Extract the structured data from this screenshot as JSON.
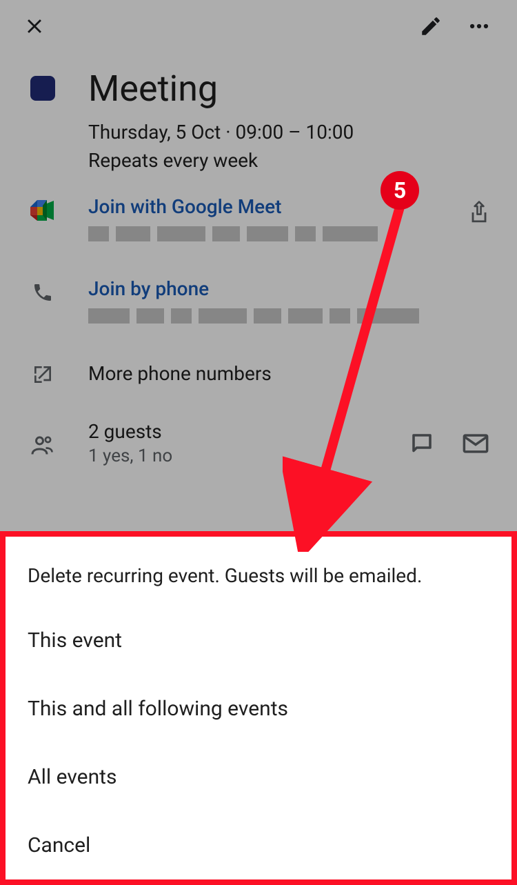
{
  "header": {
    "close_label": "Close",
    "edit_label": "Edit",
    "more_label": "More options"
  },
  "event": {
    "color": "#212c76",
    "title": "Meeting",
    "date_line": "Thursday, 5 Oct · 09:00 – 10:00",
    "repeat_line": "Repeats every week"
  },
  "meet": {
    "join_label": "Join with Google Meet",
    "share_label": "Share"
  },
  "phone": {
    "join_label": "Join by phone"
  },
  "more_numbers": {
    "label": "More phone numbers"
  },
  "guests": {
    "title": "2 guests",
    "summary": "1 yes, 1 no",
    "chat_label": "Chat",
    "email_label": "Email"
  },
  "sheet": {
    "title": "Delete recurring event. Guests will be emailed.",
    "options": [
      "This event",
      "This and all following events",
      "All events",
      "Cancel"
    ]
  },
  "annotation": {
    "badge": "5"
  }
}
